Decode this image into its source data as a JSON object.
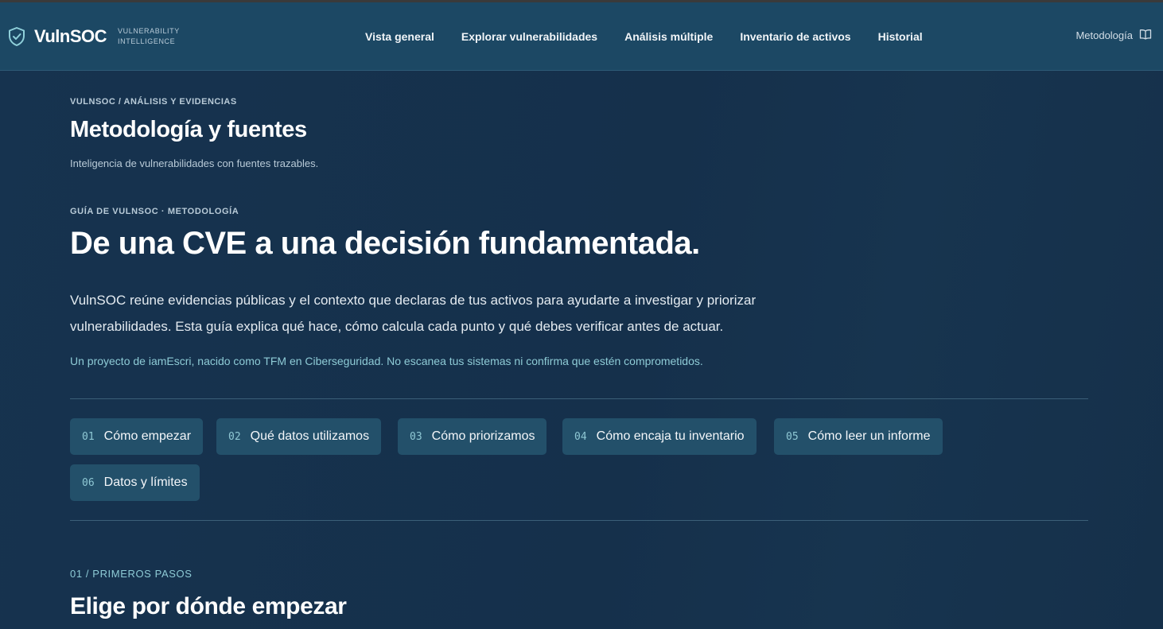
{
  "header": {
    "brand": "VulnSOC",
    "brand_sub_1": "VULNERABILITY",
    "brand_sub_2": "INTELLIGENCE",
    "nav": [
      {
        "label": "Vista general"
      },
      {
        "label": "Explorar vulnerabilidades"
      },
      {
        "label": "Análisis múltiple"
      },
      {
        "label": "Inventario de activos"
      },
      {
        "label": "Historial"
      }
    ],
    "methodology_link": "Metodología",
    "methodology_icon": "book-open-icon",
    "brand_icon": "shield-check-icon"
  },
  "page": {
    "breadcrumb": "VULNSOC / ANÁLISIS Y EVIDENCIAS",
    "title": "Metodología y fuentes",
    "subtitle": "Inteligencia de vulnerabilidades con fuentes trazables."
  },
  "guide": {
    "eyebrow": "GUÍA DE VULNSOC · METODOLOGÍA",
    "hero": "De una CVE a una decisión fundamentada.",
    "lead": "VulnSOC reúne evidencias públicas y el contexto que declaras de tus activos para ayudarte a investigar y priorizar vulnerabilidades. Esta guía explica qué hace, cómo calcula cada punto y qué debes verificar antes de actuar.",
    "note": "Un proyecto de iamEscri, nacido como TFM en Ciberseguridad. No escanea tus sistemas ni confirma que estén comprometidos."
  },
  "chips": [
    {
      "num": "01",
      "label": "Cómo empezar"
    },
    {
      "num": "02",
      "label": "Qué datos utilizamos"
    },
    {
      "num": "03",
      "label": "Cómo priorizamos"
    },
    {
      "num": "04",
      "label": "Cómo encaja tu inventario"
    },
    {
      "num": "05",
      "label": "Cómo leer un informe"
    },
    {
      "num": "06",
      "label": "Datos y límites"
    }
  ],
  "section": {
    "tag": "01 / PRIMEROS PASOS",
    "title": "Elige por dónde empezar"
  },
  "colors": {
    "background": "#15304a",
    "header": "#1c4864",
    "chip": "#23506a",
    "accent": "#8ecbd6"
  }
}
